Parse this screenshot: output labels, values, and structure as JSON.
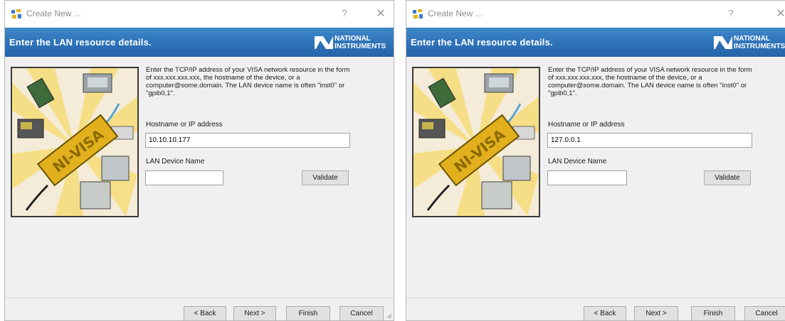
{
  "windows": [
    {
      "title": "Create New ...",
      "help_glyph": "?",
      "close_glyph": "✕",
      "banner_title": "Enter the LAN resource details.",
      "logo_text_line1": "NATIONAL",
      "logo_text_line2": "INSTRUMENTS",
      "illustration_text": "NI-VISA",
      "description": "Enter the TCP/IP address of your VISA network resource in the form of xxx.xxx.xxx.xxx, the hostname of the device, or a computer@some.domain. The LAN device name is often \"inst0\" or \"gpib0,1\".",
      "hostname_label": "Hostname or IP address",
      "hostname_value": "10.10.10.177",
      "device_name_label": "LAN Device Name",
      "device_name_value": "",
      "validate_label": "Validate",
      "back_label": "< Back",
      "next_label": "Next >",
      "finish_label": "Finish",
      "cancel_label": "Cancel"
    },
    {
      "title": "Create New ...",
      "help_glyph": "?",
      "close_glyph": "✕",
      "banner_title": "Enter the LAN resource details.",
      "logo_text_line1": "NATIONAL",
      "logo_text_line2": "INSTRUMENTS",
      "illustration_text": "NI-VISA",
      "description": "Enter the TCP/IP address of your VISA network resource in the form of xxx.xxx.xxx.xxx, the hostname of the device, or a computer@some.domain. The LAN device name is often \"inst0\" or \"gpib0,1\".",
      "hostname_label": "Hostname or IP address",
      "hostname_value": "127.0.0.1",
      "device_name_label": "LAN Device Name",
      "device_name_value": "",
      "validate_label": "Validate",
      "back_label": "< Back",
      "next_label": "Next >",
      "finish_label": "Finish",
      "cancel_label": "Cancel"
    }
  ],
  "colors": {
    "banner": "#2e72b8",
    "logo": "#ffffff",
    "illustration_bg": "#f4ecd8",
    "ni_visa_block": "#e2b01c"
  }
}
